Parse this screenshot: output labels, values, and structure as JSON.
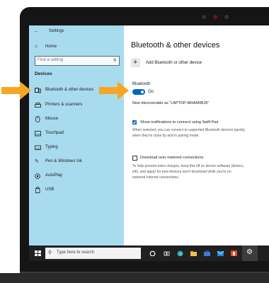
{
  "window": {
    "back_icon": "back-arrow-icon",
    "title": "Settings"
  },
  "sidebar": {
    "home": "Home",
    "search_placeholder": "Find a setting",
    "section": "Devices",
    "items": [
      {
        "label": "Bluetooth & other devices",
        "icon": "bluetooth-devices-icon"
      },
      {
        "label": "Printers & scanners",
        "icon": "printer-icon"
      },
      {
        "label": "Mouse",
        "icon": "mouse-icon"
      },
      {
        "label": "Touchpad",
        "icon": "touchpad-icon"
      },
      {
        "label": "Typing",
        "icon": "keyboard-icon"
      },
      {
        "label": "Pen & Windows Ink",
        "icon": "pen-icon"
      },
      {
        "label": "AutoPlay",
        "icon": "autoplay-icon"
      },
      {
        "label": "USB",
        "icon": "usb-icon"
      }
    ]
  },
  "main": {
    "title": "Bluetooth & other devices",
    "add_label": "Add Bluetooth or other device",
    "bluetooth_heading": "Bluetooth",
    "bluetooth_state": "On",
    "discoverable": "Now discoverable as \"LAPTOP-MHA6RBJ6\"",
    "swift_pair_label": "Show notifications to connect using Swift Pair",
    "swift_pair_desc_1": "When selected, you can connect to supported Bluetooth devices quickly",
    "swift_pair_desc_2": "when they're close by and in pairing mode.",
    "metered_label": "Download over metered connections",
    "metered_desc_1": "To help prevent extra charges, keep this off so device software (drivers,",
    "metered_desc_2": "info, and apps) for new devices won't download while you're on",
    "metered_desc_3": "metered Internet connections."
  },
  "taskbar": {
    "search_placeholder": "Type here to search"
  },
  "colors": {
    "accent": "#0067c0",
    "sidebar_bg": "#a9dbef",
    "arrow": "#f5a623"
  }
}
